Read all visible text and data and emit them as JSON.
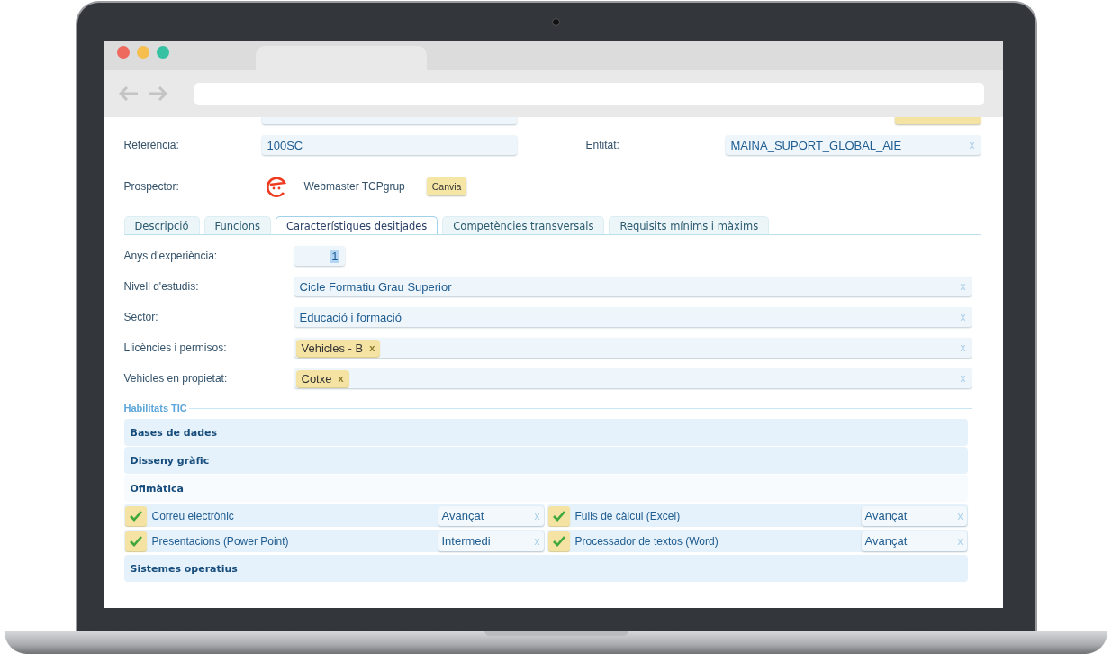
{
  "header_fields": [
    {
      "label": "Referència:",
      "value": "100SC"
    },
    {
      "label": "Entitat:",
      "value": "MAINA_SUPORT_GLOBAL_AIE",
      "clear": "x"
    }
  ],
  "prospector": {
    "label": "Prospector:",
    "name": "Webmaster TCPgrup",
    "button": "Canvia"
  },
  "tabs": [
    {
      "label": "Descripció",
      "selected": false
    },
    {
      "label": "Funcions",
      "selected": false
    },
    {
      "label": "Característiques desitjades",
      "selected": true
    },
    {
      "label": "Competències transversals",
      "selected": false
    },
    {
      "label": "Requisits mínims i màxims",
      "selected": false
    }
  ],
  "form_rows": [
    {
      "kind": "number",
      "label": "Anys d'experiència:",
      "value": "1"
    },
    {
      "kind": "select",
      "label": "Nivell d'estudis:",
      "value": "Cicle Formatiu Grau Superior",
      "clear": "x"
    },
    {
      "kind": "select",
      "label": "Sector:",
      "value": "Educació i formació",
      "clear": "x"
    },
    {
      "kind": "tags",
      "label": "Llicències i permisos:",
      "tags": [
        {
          "text": "Vehicles - B",
          "remove": "x"
        }
      ],
      "clear": "x"
    },
    {
      "kind": "tags",
      "label": "Vehicles en propietat:",
      "tags": [
        {
          "text": "Cotxe",
          "remove": "x"
        }
      ],
      "clear": "x"
    }
  ],
  "skills": {
    "legend": "Habilitats TIC",
    "groups": [
      {
        "title": "Bases de dades",
        "expanded": false
      },
      {
        "title": "Disseny gràfic",
        "expanded": false
      },
      {
        "title": "Ofimàtica",
        "expanded": true,
        "items": [
          {
            "name": "Correu electrònic",
            "checked": true,
            "proficiency": "Avançat",
            "clear": "x"
          },
          {
            "name": "Fulls de càlcul (Excel)",
            "checked": true,
            "proficiency": "Avançat",
            "clear": "x"
          },
          {
            "name": "Presentacions (Power Point)",
            "checked": true,
            "proficiency": "Intermedi",
            "clear": "x"
          },
          {
            "name": "Processador de textos (Word)",
            "checked": true,
            "proficiency": "Avançat",
            "clear": "x"
          }
        ]
      },
      {
        "title": "Sistemes operatius",
        "expanded": false
      }
    ]
  }
}
